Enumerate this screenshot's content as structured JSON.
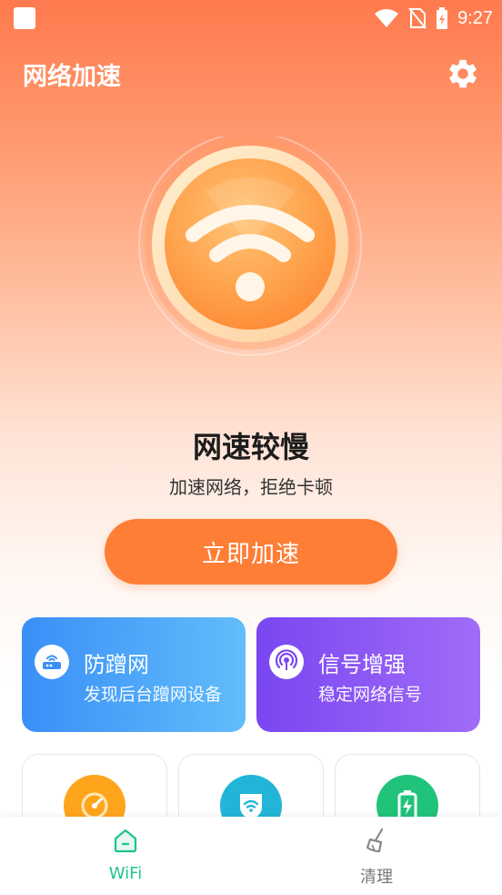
{
  "status_bar": {
    "time": "9:27"
  },
  "header": {
    "title": "网络加速"
  },
  "hero": {
    "status_title": "网速较慢",
    "status_subtitle": "加速网络，拒绝卡顿"
  },
  "accelerate_button": {
    "label": "立即加速"
  },
  "features": [
    {
      "title": "防蹭网",
      "subtitle": "发现后台蹭网设备",
      "icon": "router-icon"
    },
    {
      "title": "信号增强",
      "subtitle": "稳定网络信号",
      "icon": "signal-broadcast-icon"
    }
  ],
  "tools": [
    {
      "icon": "speedometer-icon",
      "color": "#ffa51c"
    },
    {
      "icon": "wifi-shield-icon",
      "color": "#22b5d8"
    },
    {
      "icon": "battery-charge-icon",
      "color": "#20c37a"
    }
  ],
  "bottom_nav": [
    {
      "label": "WiFi",
      "icon": "home-icon",
      "active": true
    },
    {
      "label": "清理",
      "icon": "broom-icon",
      "active": false
    }
  ],
  "colors": {
    "accent_orange": "#ff7e36",
    "active_green": "#1dc48a"
  }
}
